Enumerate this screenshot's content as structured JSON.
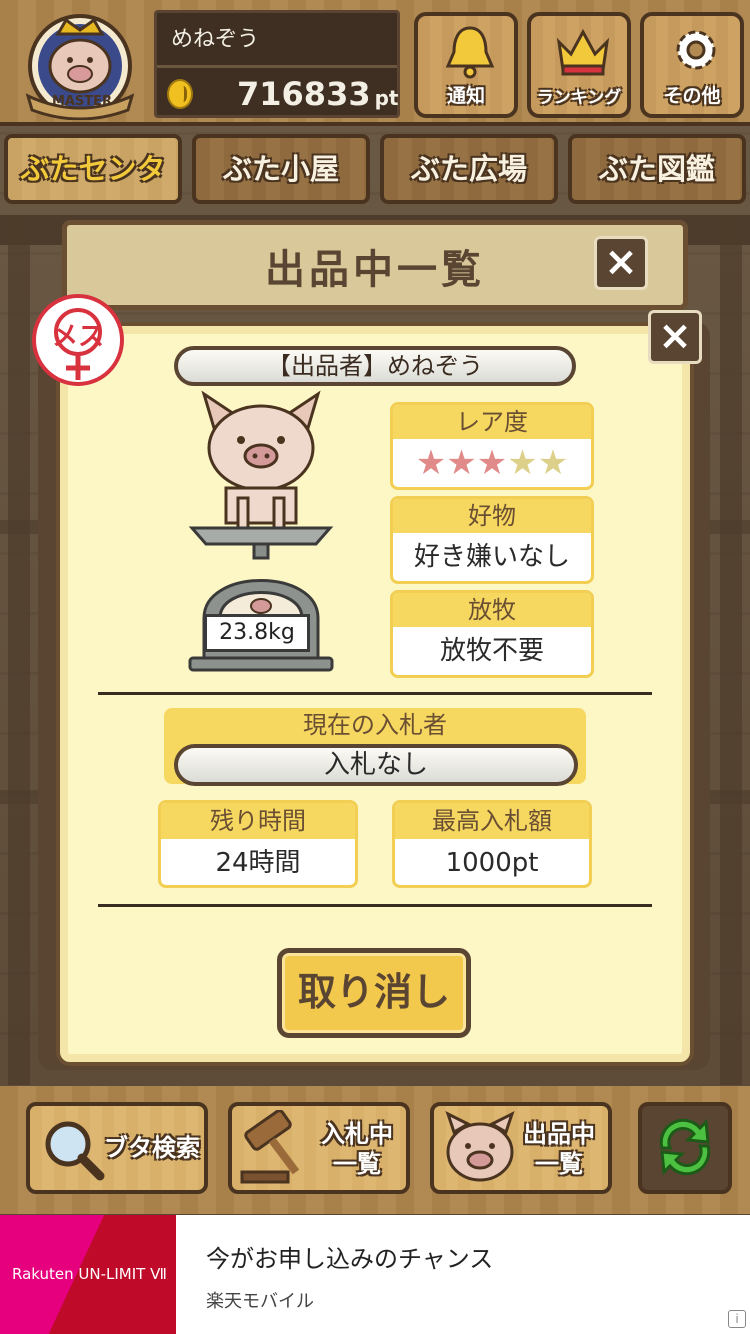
{
  "header": {
    "emblem_label": "MASTER",
    "user_name": "めねぞう",
    "points": "716833",
    "points_unit": "pt",
    "buttons": [
      {
        "label": "通知",
        "icon": "bell-icon"
      },
      {
        "label": "ランキング",
        "icon": "crown-icon"
      },
      {
        "label": "その他",
        "icon": "gear-icon"
      }
    ]
  },
  "tabs": [
    {
      "label": "ぶたセンター",
      "active": true
    },
    {
      "label": "ぶた小屋"
    },
    {
      "label": "ぶた広場"
    },
    {
      "label": "ぶた図鑑"
    }
  ],
  "back_dialog": {
    "title": "出品中一覧"
  },
  "dialog": {
    "gender_badge": "メス",
    "seller": "【出品者】めねぞう",
    "weight": "23.8kg",
    "rarity": {
      "label": "レア度",
      "stars_filled": 3,
      "stars_total": 5
    },
    "favorite": {
      "label": "好物",
      "value": "好き嫌いなし"
    },
    "grazing": {
      "label": "放牧",
      "value": "放牧不要"
    },
    "current_bidder": {
      "label": "現在の入札者",
      "value": "入札なし"
    },
    "time_left": {
      "label": "残り時間",
      "value": "24時間"
    },
    "highest_bid": {
      "label": "最高入札額",
      "value": "1000pt"
    },
    "cancel_button": "取り消し"
  },
  "toolbar": {
    "search": "ブタ検索",
    "bidding_line1": "入札中",
    "bidding_line2": "一覧",
    "listing_line1": "出品中",
    "listing_line2": "一覧"
  },
  "ad": {
    "brand": "Rakuten UN-LIMIT Ⅶ",
    "title": "今がお申し込みのチャンス",
    "subtitle": "楽天モバイル",
    "info": "i"
  },
  "colors": {
    "accent": "#f6d760",
    "wood": "#a8814a",
    "dark": "#5a4532",
    "female": "#d8323f"
  }
}
